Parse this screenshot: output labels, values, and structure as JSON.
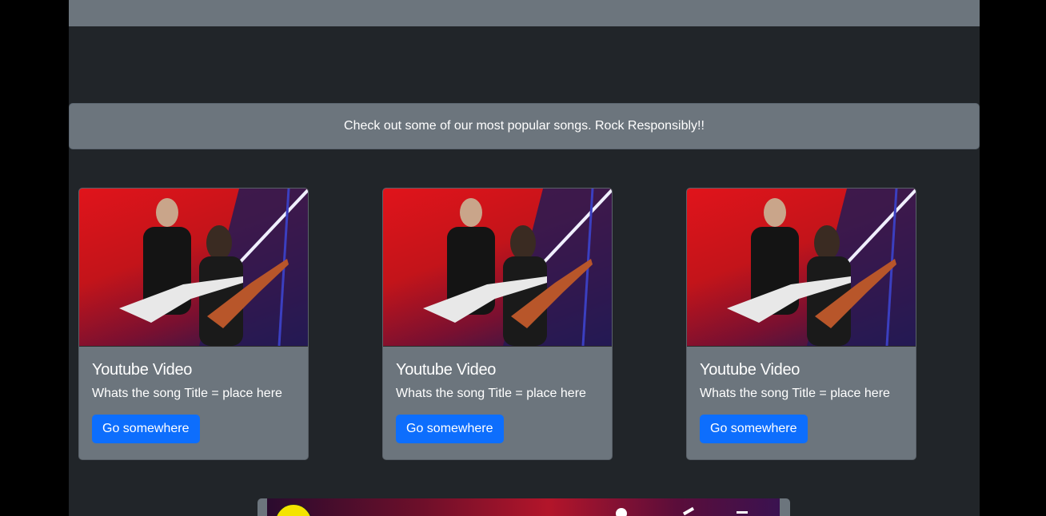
{
  "banner": {
    "text": "Check out some of our most popular songs. Rock Responsibly!!"
  },
  "cards": [
    {
      "image_alt": "Concert photo of two guitarists on stage",
      "title": "Youtube Video",
      "text": "Whats the song Title = place here",
      "button_label": "Go somewhere"
    },
    {
      "image_alt": "Concert photo of two guitarists on stage",
      "title": "Youtube Video",
      "text": "Whats the song Title = place here",
      "button_label": "Go somewhere"
    },
    {
      "image_alt": "Concert photo of two guitarists on stage",
      "title": "Youtube Video",
      "text": "Whats the song Title = place here",
      "button_label": "Go somewhere"
    }
  ],
  "colors": {
    "page_bg": "#212529",
    "panel_bg": "#6c757d",
    "button_bg": "#0d6efd",
    "outer_bg": "#000000"
  },
  "icons": {
    "player_logo": "channel-logo-icon",
    "player_info": "info-icon",
    "player_share": "share-icon",
    "player_menu": "menu-icon"
  }
}
